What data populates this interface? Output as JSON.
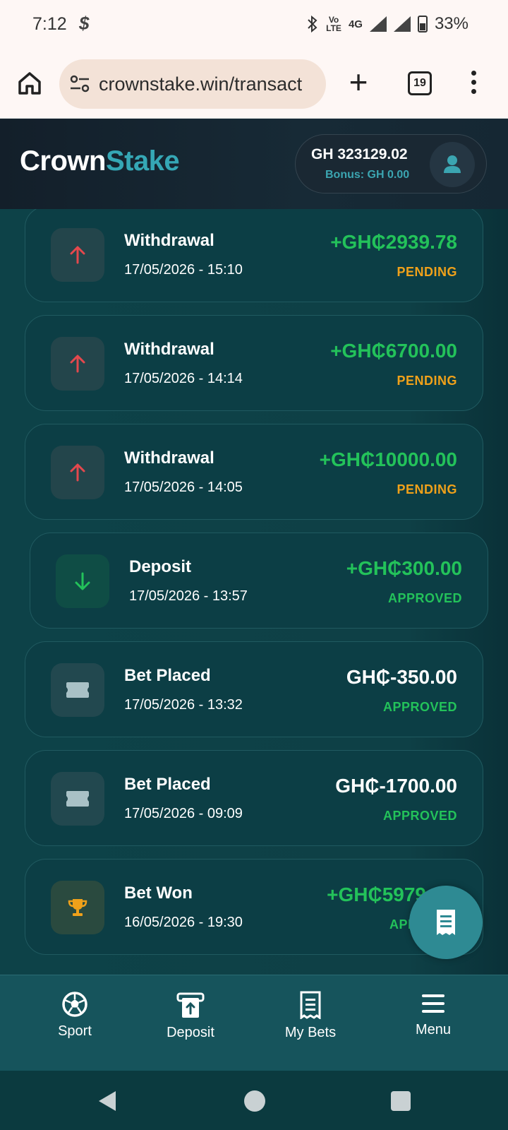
{
  "status_bar": {
    "time": "7:12",
    "network": "4G",
    "battery": "33%",
    "volte": "Vo\nLTE"
  },
  "browser": {
    "url": "crownstake.win/transact",
    "tab_count": "19"
  },
  "header": {
    "logo_part1": "Crown",
    "logo_part2": "Stake",
    "balance": "GH 323129.02",
    "bonus": "Bonus: GH 0.00"
  },
  "transactions": [
    {
      "type": "Withdrawal",
      "datetime": "17/05/2026 - 15:10",
      "amount": "+GH₵2939.78",
      "status": "PENDING",
      "icon": "arrow-up-icon"
    },
    {
      "type": "Withdrawal",
      "datetime": "17/05/2026 - 14:14",
      "amount": "+GH₵6700.00",
      "status": "PENDING",
      "icon": "arrow-up-icon"
    },
    {
      "type": "Withdrawal",
      "datetime": "17/05/2026 - 14:05",
      "amount": "+GH₵10000.00",
      "status": "PENDING",
      "icon": "arrow-up-icon"
    },
    {
      "type": "Deposit",
      "datetime": "17/05/2026 - 13:57",
      "amount": "+GH₵300.00",
      "status": "APPROVED",
      "icon": "arrow-down-icon"
    },
    {
      "type": "Bet Placed",
      "datetime": "17/05/2026 - 13:32",
      "amount": "GH₵-350.00",
      "status": "APPROVED",
      "icon": "ticket-icon"
    },
    {
      "type": "Bet Placed",
      "datetime": "17/05/2026 - 09:09",
      "amount": "GH₵-1700.00",
      "status": "APPROVED",
      "icon": "ticket-icon"
    },
    {
      "type": "Bet Won",
      "datetime": "16/05/2026 - 19:30",
      "amount": "+GH₵5979",
      "status": "APPR",
      "icon": "trophy-icon"
    }
  ],
  "bottom_nav": [
    {
      "label": "Sport",
      "icon": "soccer-ball-icon"
    },
    {
      "label": "Deposit",
      "icon": "deposit-icon"
    },
    {
      "label": "My Bets",
      "icon": "receipt-icon"
    },
    {
      "label": "Menu",
      "icon": "hamburger-icon"
    }
  ],
  "colors": {
    "accent": "#35a7b5",
    "positive": "#23c25a",
    "pending": "#f0a11a",
    "negative_arrow": "#e5484d"
  }
}
